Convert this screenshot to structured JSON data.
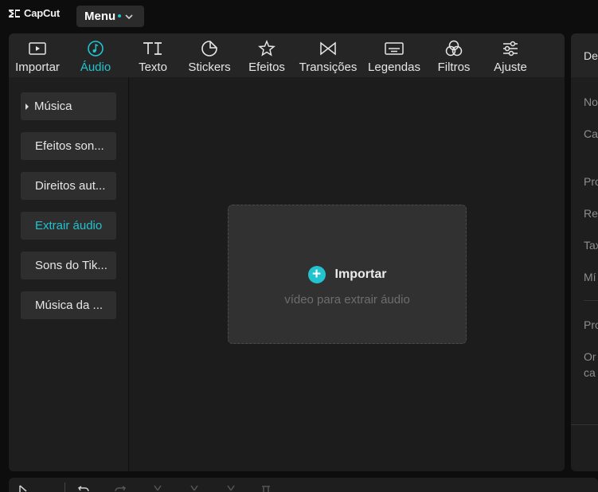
{
  "app": {
    "logo_text": "CapCut",
    "menu_label": "Menu"
  },
  "colors": {
    "accent": "#22c3cf",
    "panel": "#1e1e1f",
    "background": "#0d0d0d"
  },
  "tabs": [
    {
      "label": "Importar",
      "icon": "import-icon"
    },
    {
      "label": "Áudio",
      "icon": "audio-icon",
      "active": true
    },
    {
      "label": "Texto",
      "icon": "text-icon"
    },
    {
      "label": "Stickers",
      "icon": "sticker-icon"
    },
    {
      "label": "Efeitos",
      "icon": "effects-icon"
    },
    {
      "label": "Transições",
      "icon": "transitions-icon"
    },
    {
      "label": "Legendas",
      "icon": "captions-icon"
    },
    {
      "label": "Filtros",
      "icon": "filters-icon"
    },
    {
      "label": "Ajuste",
      "icon": "adjust-icon"
    }
  ],
  "sidebar": {
    "items": [
      {
        "label": "Música"
      },
      {
        "label": "Efeitos son..."
      },
      {
        "label": "Direitos aut..."
      },
      {
        "label": "Extrair áudio",
        "active": true
      },
      {
        "label": "Sons do Tik..."
      },
      {
        "label": "Música da ..."
      }
    ]
  },
  "dropzone": {
    "title": "Importar",
    "subtitle": "vídeo para extrair áudio"
  },
  "right_panel": {
    "header": "De",
    "rows": [
      "No",
      "Ca",
      "Pro",
      "Re",
      "Tax",
      "Mí",
      "Pro",
      "Or",
      "ca"
    ]
  }
}
